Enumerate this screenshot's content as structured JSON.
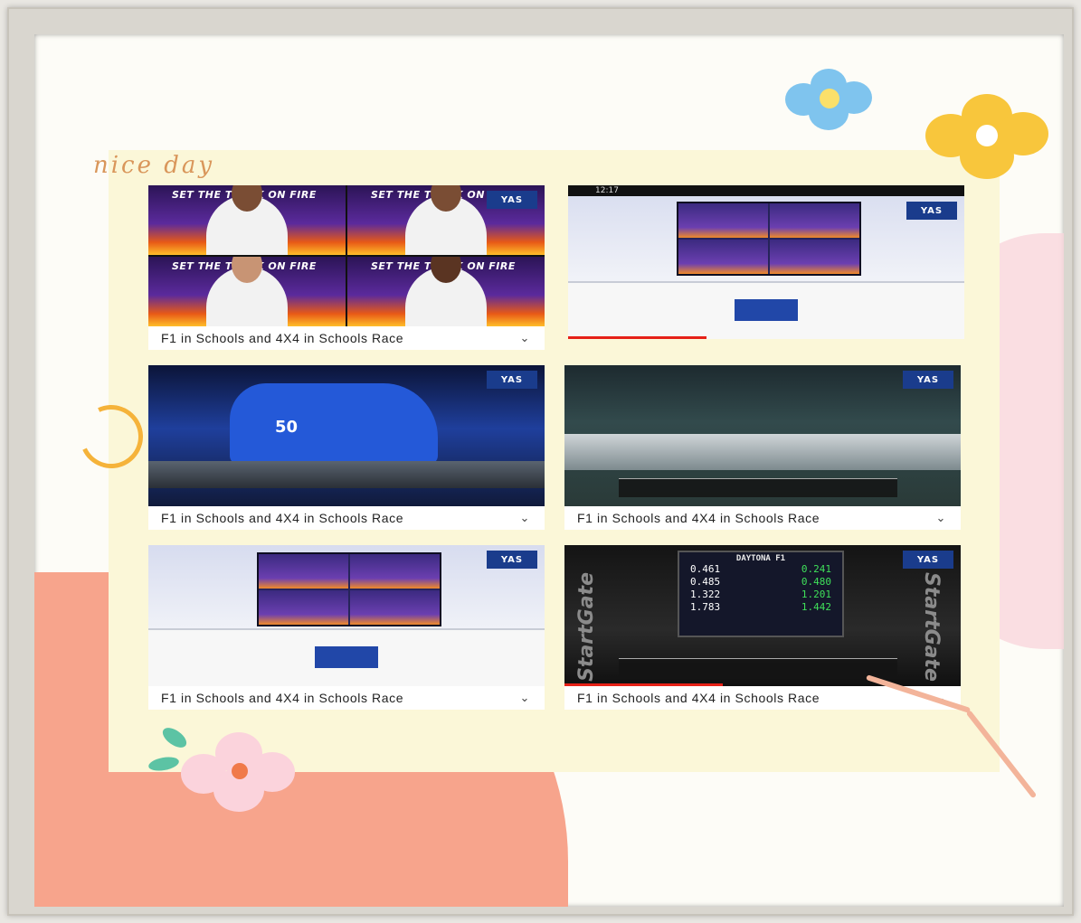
{
  "collage": {
    "title": "nice day"
  },
  "videos": [
    {
      "caption": "F1 in Schools and 4X4 in Schools Race",
      "chevron": "⌄",
      "thumbnail": "four-panel-video-call",
      "overlay_text": "SET THE TRACK ON FIRE",
      "badge": "YAS",
      "progress": 0.0
    },
    {
      "caption": "",
      "chevron": "",
      "thumbnail": "tv-studio-hosts",
      "status_time": "12:17",
      "badge": "YAS",
      "progress": 0.35
    },
    {
      "caption": "F1 in Schools and 4X4 in Schools Race",
      "chevron": "⌄",
      "thumbnail": "blue-race-car",
      "car_number": "50",
      "badge": "YAS",
      "progress": 0.0
    },
    {
      "caption": "F1 in Schools and 4X4 in Schools Race",
      "chevron": "⌄",
      "thumbnail": "race-track-timing",
      "badge": "YAS",
      "progress": 0.0
    },
    {
      "caption": "F1 in Schools and 4X4 in Schools Race",
      "chevron": "⌄",
      "thumbnail": "tv-studio-hosts",
      "badge": "YAS",
      "progress": 0.0
    },
    {
      "caption": "F1 in Schools and 4X4 in Schools Race",
      "chevron": "⌄",
      "thumbnail": "start-gate-timing",
      "timing_title": "DAYTONA F1",
      "side_text": "StartGate",
      "timing_left": [
        "0.461",
        "0.485",
        "1.322",
        "1.783"
      ],
      "timing_right": [
        "0.241",
        "0.480",
        "1.201",
        "1.442"
      ],
      "badge": "YAS",
      "progress": 0.4
    }
  ],
  "colors": {
    "background_blob": "#f7a48c",
    "paper": "#fbf7d8",
    "title": "#d9965a",
    "flower_blue": "#7fc4ee",
    "flower_yellow": "#f8c63c",
    "flower_pink": "#fbd3dc",
    "progress": "#e62117"
  }
}
